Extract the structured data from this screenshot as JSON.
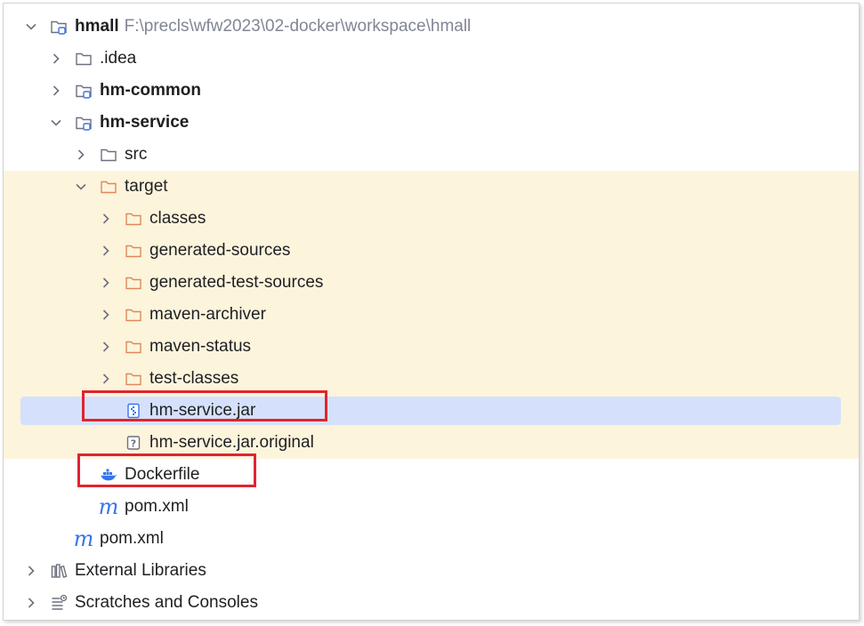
{
  "tree": {
    "root": {
      "label": "hmall",
      "path": "F:\\precls\\wfw2023\\02-docker\\workspace\\hmall"
    },
    "idea": {
      "label": ".idea"
    },
    "hm_common": {
      "label": "hm-common"
    },
    "hm_service": {
      "label": "hm-service"
    },
    "src": {
      "label": "src"
    },
    "target": {
      "label": "target"
    },
    "target_children": [
      {
        "label": "classes"
      },
      {
        "label": "generated-sources"
      },
      {
        "label": "generated-test-sources"
      },
      {
        "label": "maven-archiver"
      },
      {
        "label": "maven-status"
      },
      {
        "label": "test-classes"
      }
    ],
    "jar": {
      "label": "hm-service.jar"
    },
    "jar_original": {
      "label": "hm-service.jar.original"
    },
    "dockerfile": {
      "label": "Dockerfile"
    },
    "service_pom": {
      "label": "pom.xml"
    },
    "root_pom": {
      "label": "pom.xml"
    },
    "external_libraries": {
      "label": "External Libraries"
    },
    "scratches": {
      "label": "Scratches and Consoles"
    }
  },
  "colors": {
    "folder_gray": "#6c707e",
    "folder_orange": "#e08855",
    "module_badge": "#3574f0",
    "selection": "#d5e1fc",
    "excluded_band": "#fdf4dc",
    "highlight_box": "#e0242f"
  }
}
